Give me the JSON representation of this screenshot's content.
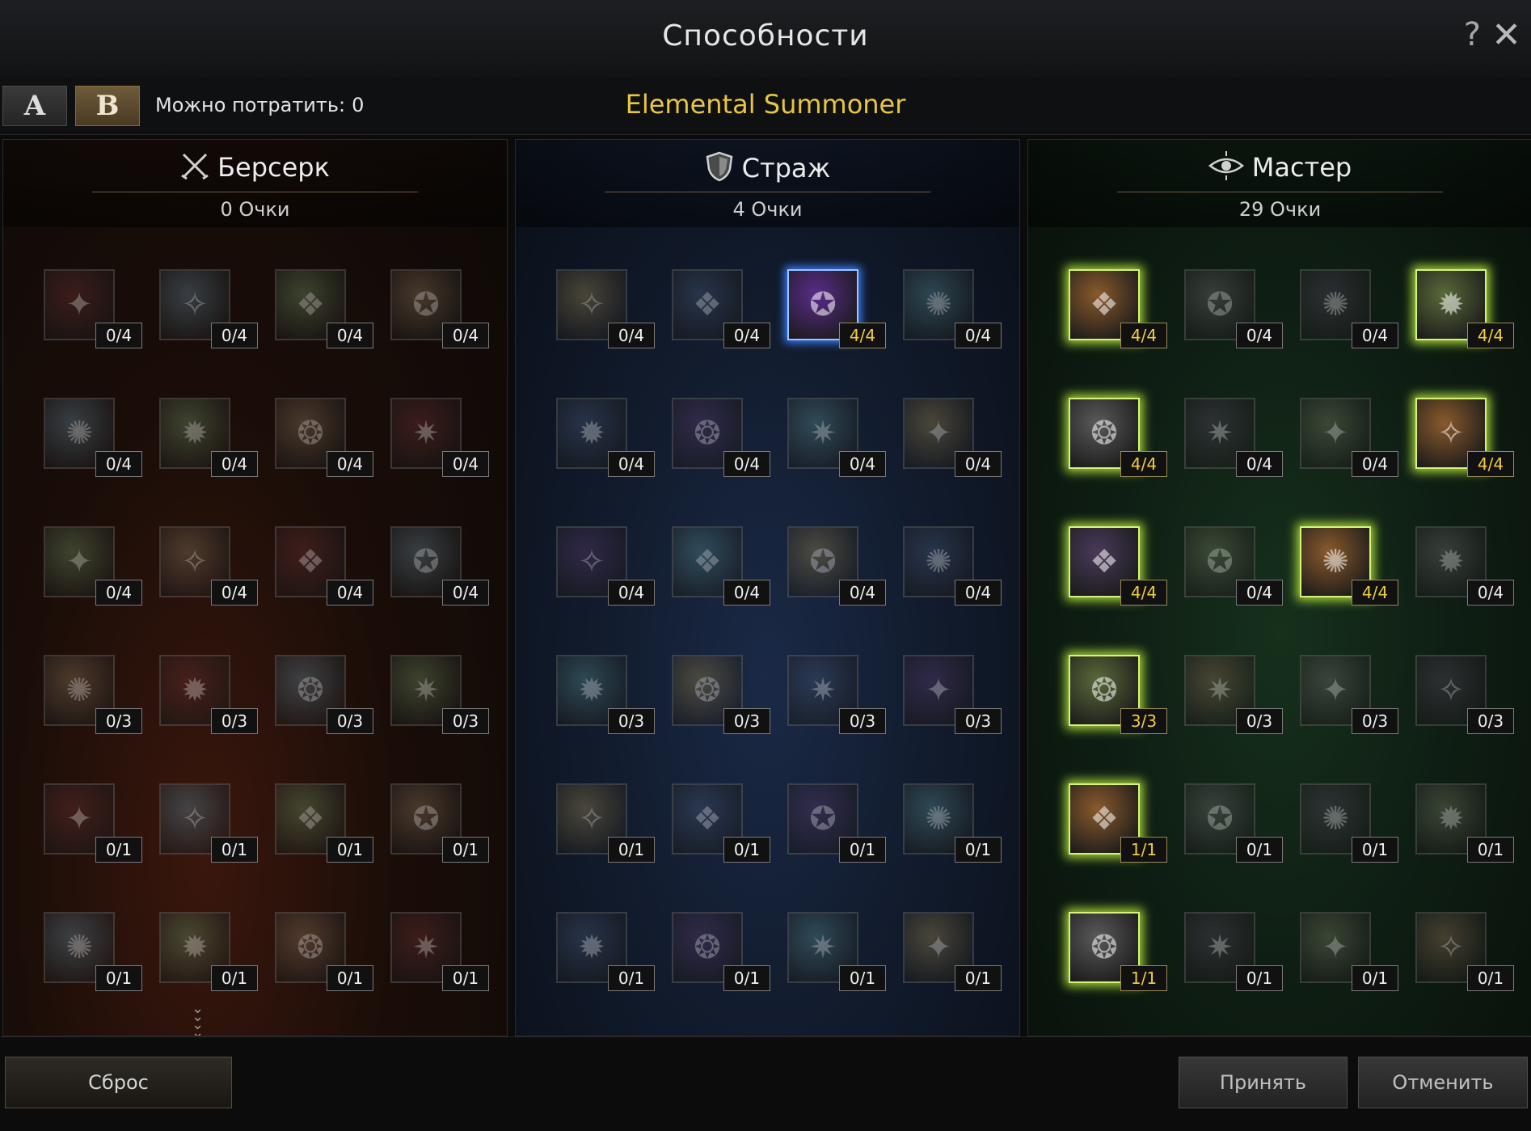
{
  "window": {
    "title": "Способности",
    "help_label": "?",
    "close_label": "✕"
  },
  "presets": [
    "A",
    "B"
  ],
  "active_preset": "B",
  "spend": {
    "label": "Можно потратить:",
    "value": "0"
  },
  "class_name": "Elemental Summoner",
  "colors": {
    "accent_gold": "#e8c63e",
    "learned_blue": "#3a7fff",
    "learned_green": "#a6d63a"
  },
  "panels": [
    {
      "name": "Берсерк",
      "icon": "crossed-swords-icon",
      "points": "0 Очки",
      "rows": [
        [
          "0/4",
          "0/4",
          "0/4",
          "0/4"
        ],
        [
          "0/4",
          "0/4",
          "0/4",
          "0/4"
        ],
        [
          "0/4",
          "0/4",
          "0/4",
          "0/4"
        ],
        [
          "0/3",
          "0/3",
          "0/3",
          "0/3"
        ],
        [
          "0/1",
          "0/1",
          "0/1",
          "0/1"
        ],
        [
          "0/1",
          "0/1",
          "0/1",
          "0/1"
        ]
      ]
    },
    {
      "name": "Страж",
      "icon": "shield-icon",
      "points": "4 Очки",
      "rows": [
        [
          "0/4",
          "0/4",
          "4/4",
          "0/4"
        ],
        [
          "0/4",
          "0/4",
          "0/4",
          "0/4"
        ],
        [
          "0/4",
          "0/4",
          "0/4",
          "0/4"
        ],
        [
          "0/3",
          "0/3",
          "0/3",
          "0/3"
        ],
        [
          "0/1",
          "0/1",
          "0/1",
          "0/1"
        ],
        [
          "0/1",
          "0/1",
          "0/1",
          "0/1"
        ]
      ]
    },
    {
      "name": "Мастер",
      "icon": "eye-icon",
      "points": "29 Очки",
      "rows": [
        [
          "4/4",
          "0/4",
          "0/4",
          "4/4"
        ],
        [
          "4/4",
          "0/4",
          "0/4",
          "4/4"
        ],
        [
          "4/4",
          "0/4",
          "4/4",
          "0/4"
        ],
        [
          "3/3",
          "0/3",
          "0/3",
          "0/3"
        ],
        [
          "1/1",
          "0/1",
          "0/1",
          "0/1"
        ],
        [
          "1/1",
          "0/1",
          "0/1",
          "0/1"
        ]
      ]
    }
  ],
  "buttons": {
    "reset": "Сброс",
    "accept": "Принять",
    "cancel": "Отменить"
  }
}
